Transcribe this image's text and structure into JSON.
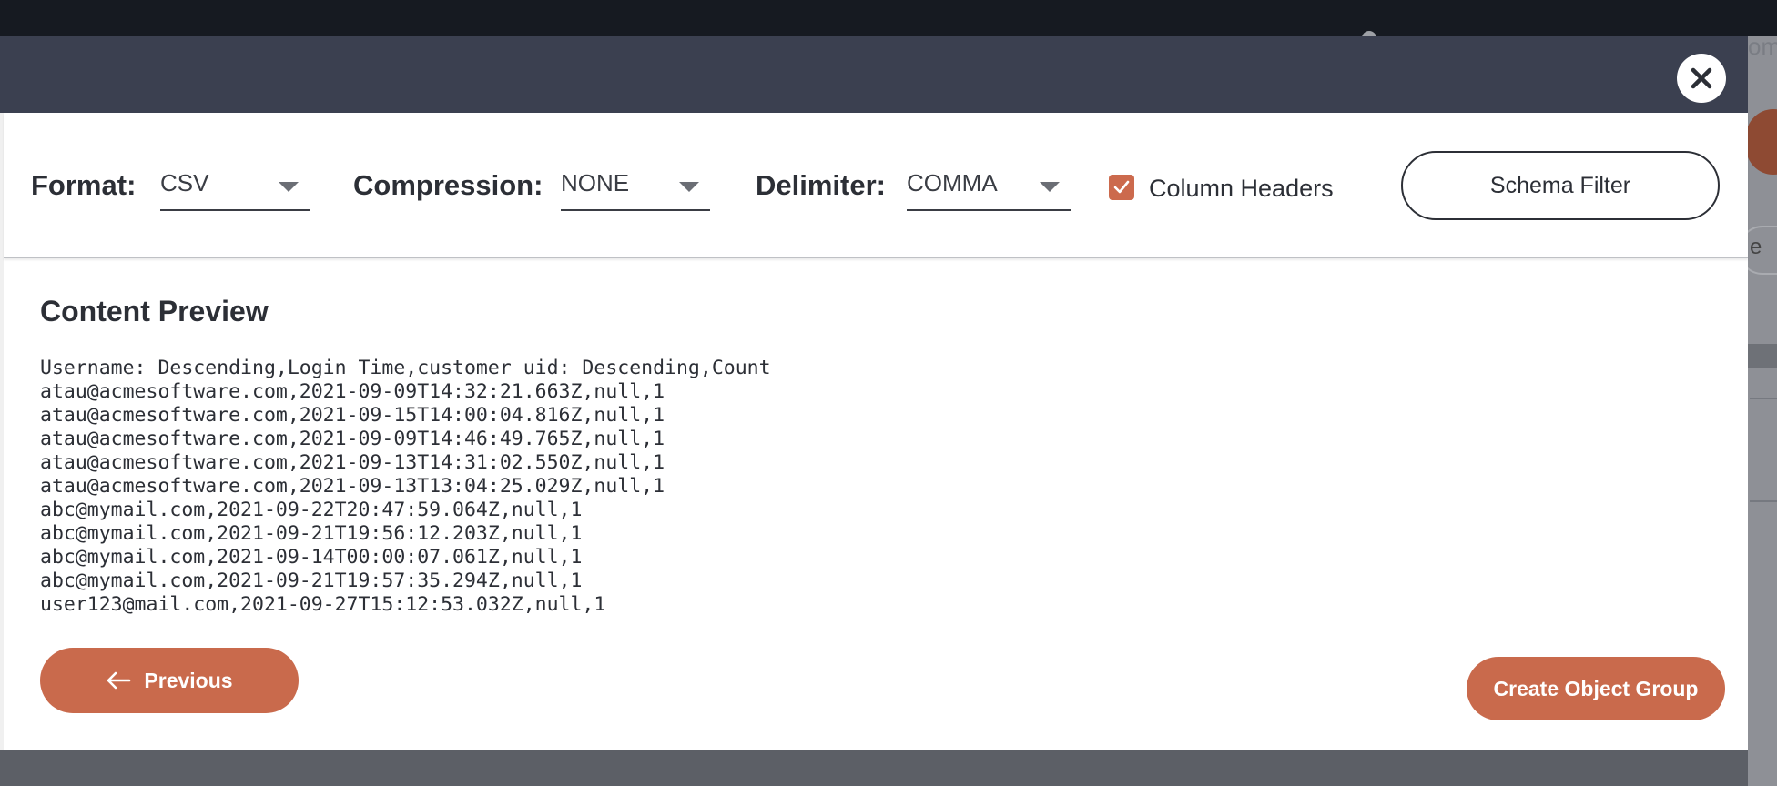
{
  "background": {
    "partial_title": "om",
    "partial_button": "e"
  },
  "modal": {
    "close_icon": "close-icon",
    "options": {
      "format_label": "Format:",
      "format_value": "CSV",
      "compression_label": "Compression:",
      "compression_value": "NONE",
      "delimiter_label": "Delimiter:",
      "delimiter_value": "COMMA",
      "column_headers_label": "Column Headers",
      "column_headers_checked": true,
      "schema_filter_label": "Schema Filter"
    },
    "preview": {
      "title": "Content Preview",
      "lines": [
        "Username: Descending,Login Time,customer_uid: Descending,Count",
        "atau@acmesoftware.com,2021-09-09T14:32:21.663Z,null,1",
        "atau@acmesoftware.com,2021-09-15T14:00:04.816Z,null,1",
        "atau@acmesoftware.com,2021-09-09T14:46:49.765Z,null,1",
        "atau@acmesoftware.com,2021-09-13T14:31:02.550Z,null,1",
        "atau@acmesoftware.com,2021-09-13T13:04:25.029Z,null,1",
        "abc@mymail.com,2021-09-22T20:47:59.064Z,null,1",
        "abc@mymail.com,2021-09-21T19:56:12.203Z,null,1",
        "abc@mymail.com,2021-09-14T00:00:07.061Z,null,1",
        "abc@mymail.com,2021-09-21T19:57:35.294Z,null,1",
        "user123@mail.com,2021-09-27T15:12:53.032Z,null,1"
      ]
    },
    "footer": {
      "previous_label": "Previous",
      "create_label": "Create Object Group"
    },
    "colors": {
      "accent": "#c96a4c",
      "header": "#3b4050"
    }
  }
}
